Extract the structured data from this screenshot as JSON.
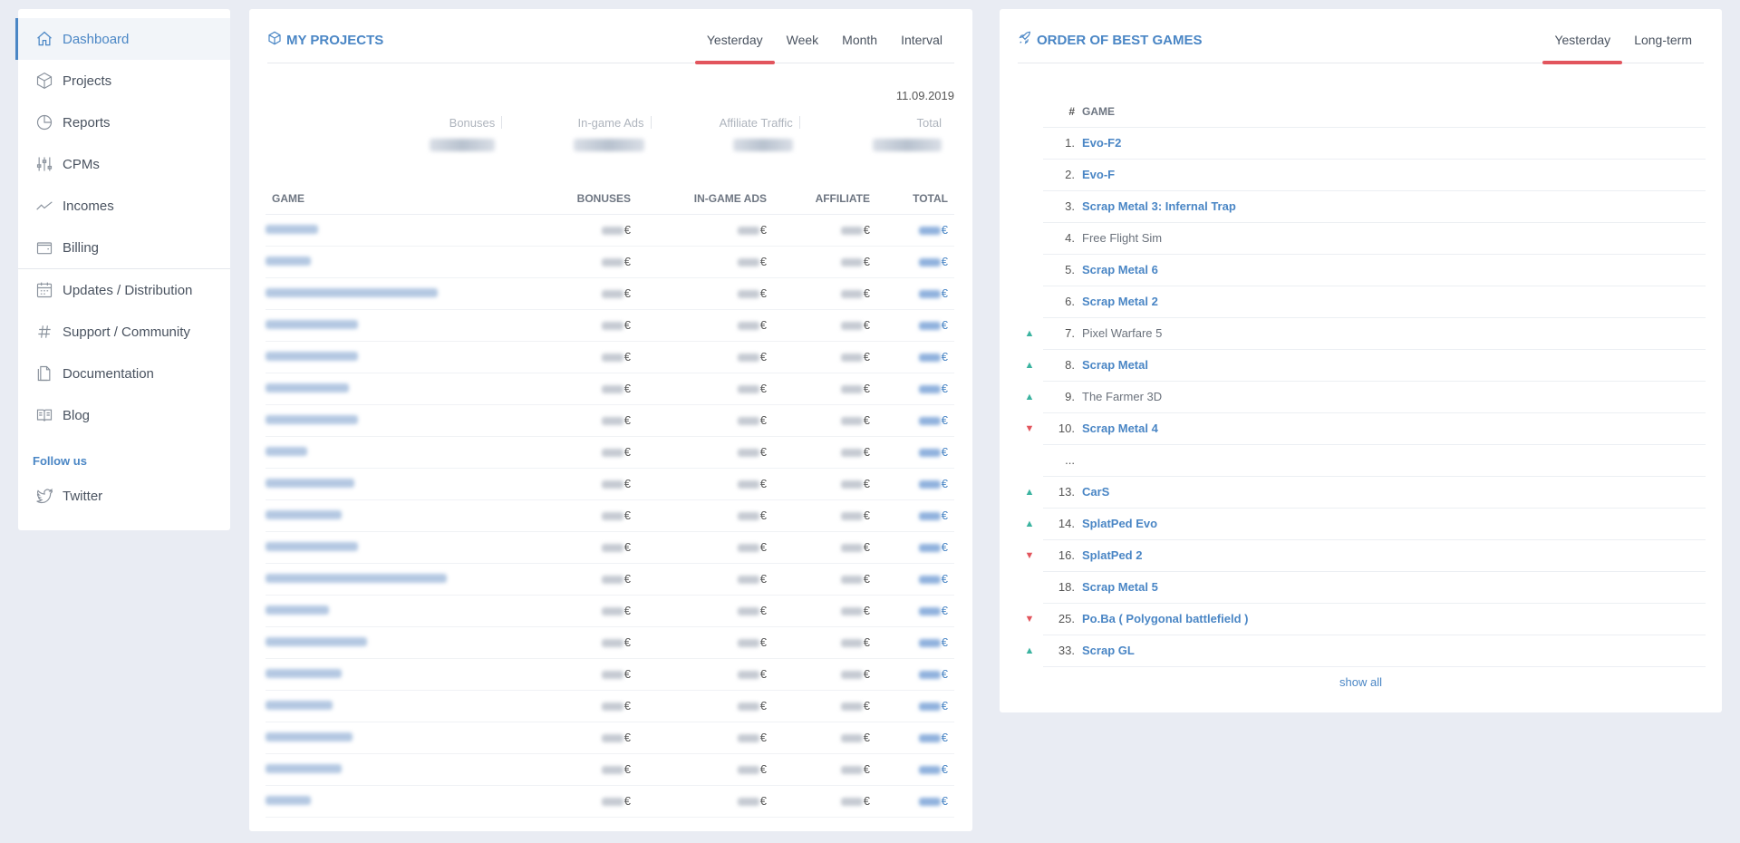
{
  "sidebar": {
    "items": [
      {
        "label": "Dashboard",
        "icon": "home-icon",
        "active": true
      },
      {
        "label": "Projects",
        "icon": "cube-icon"
      },
      {
        "label": "Reports",
        "icon": "pie-chart-icon"
      },
      {
        "label": "CPMs",
        "icon": "sliders-icon"
      },
      {
        "label": "Incomes",
        "icon": "trend-line-icon"
      },
      {
        "label": "Billing",
        "icon": "wallet-icon"
      }
    ],
    "items2": [
      {
        "label": "Updates / Distribution",
        "icon": "calendar-icon"
      },
      {
        "label": "Support / Community",
        "icon": "hash-icon"
      },
      {
        "label": "Documentation",
        "icon": "document-icon"
      },
      {
        "label": "Blog",
        "icon": "book-icon"
      }
    ],
    "follow_title": "Follow us",
    "twitter_label": "Twitter"
  },
  "projects": {
    "title": "MY PROJECTS",
    "tabs": [
      "Yesterday",
      "Week",
      "Month",
      "Interval"
    ],
    "active_tab": "Yesterday",
    "date": "11.09.2019",
    "summary_labels": [
      "Bonuses",
      "In-game Ads",
      "Affiliate Traffic",
      "Total"
    ],
    "columns": [
      "GAME",
      "BONUSES",
      "IN-GAME ADS",
      "AFFILIATE",
      "TOTAL"
    ],
    "currency": "€",
    "row_count": 19
  },
  "games": {
    "title": "ORDER OF BEST GAMES",
    "tabs": [
      "Yesterday",
      "Long-term"
    ],
    "active_tab": "Yesterday",
    "columns": [
      "#",
      "GAME"
    ],
    "rows": [
      {
        "trend": "",
        "rank": "1.",
        "name": "Evo-F2",
        "link": true
      },
      {
        "trend": "",
        "rank": "2.",
        "name": "Evo-F",
        "link": true
      },
      {
        "trend": "",
        "rank": "3.",
        "name": "Scrap Metal 3: Infernal Trap",
        "link": true
      },
      {
        "trend": "",
        "rank": "4.",
        "name": "Free Flight Sim",
        "link": false
      },
      {
        "trend": "",
        "rank": "5.",
        "name": "Scrap Metal 6",
        "link": true
      },
      {
        "trend": "",
        "rank": "6.",
        "name": "Scrap Metal 2",
        "link": true
      },
      {
        "trend": "up",
        "rank": "7.",
        "name": "Pixel Warfare 5",
        "link": false
      },
      {
        "trend": "up",
        "rank": "8.",
        "name": "Scrap Metal",
        "link": true
      },
      {
        "trend": "up",
        "rank": "9.",
        "name": "The Farmer 3D",
        "link": false
      },
      {
        "trend": "down",
        "rank": "10.",
        "name": "Scrap Metal 4",
        "link": true
      },
      {
        "trend": "",
        "rank": "...",
        "name": "",
        "link": false
      },
      {
        "trend": "up",
        "rank": "13.",
        "name": "CarS",
        "link": true
      },
      {
        "trend": "up",
        "rank": "14.",
        "name": "SplatPed Evo",
        "link": true
      },
      {
        "trend": "down",
        "rank": "16.",
        "name": "SplatPed 2",
        "link": true
      },
      {
        "trend": "",
        "rank": "18.",
        "name": "Scrap Metal 5",
        "link": true
      },
      {
        "trend": "down",
        "rank": "25.",
        "name": "Po.Ba ( Polygonal battlefield )",
        "link": true
      },
      {
        "trend": "up",
        "rank": "33.",
        "name": "Scrap GL",
        "link": true
      }
    ],
    "show_all": "show all"
  }
}
